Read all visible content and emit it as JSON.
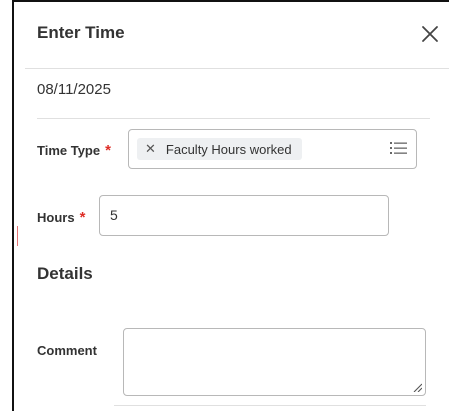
{
  "dialog": {
    "title": "Enter Time",
    "close_icon": "close-icon",
    "date": "08/11/2025"
  },
  "time_type": {
    "label": "Time Type",
    "required_marker": "*",
    "selected_value": "Faculty Hours worked",
    "remove_icon": "remove-icon",
    "list_icon": "list-icon"
  },
  "hours": {
    "label": "Hours",
    "required_marker": "*",
    "value": "5"
  },
  "details": {
    "section_title": "Details"
  },
  "comment": {
    "label": "Comment",
    "value": ""
  },
  "colors": {
    "required": "#de2d26",
    "border": "#b8b8b8",
    "pill_background": "#eef0f2",
    "divider": "#e0e0e0"
  }
}
